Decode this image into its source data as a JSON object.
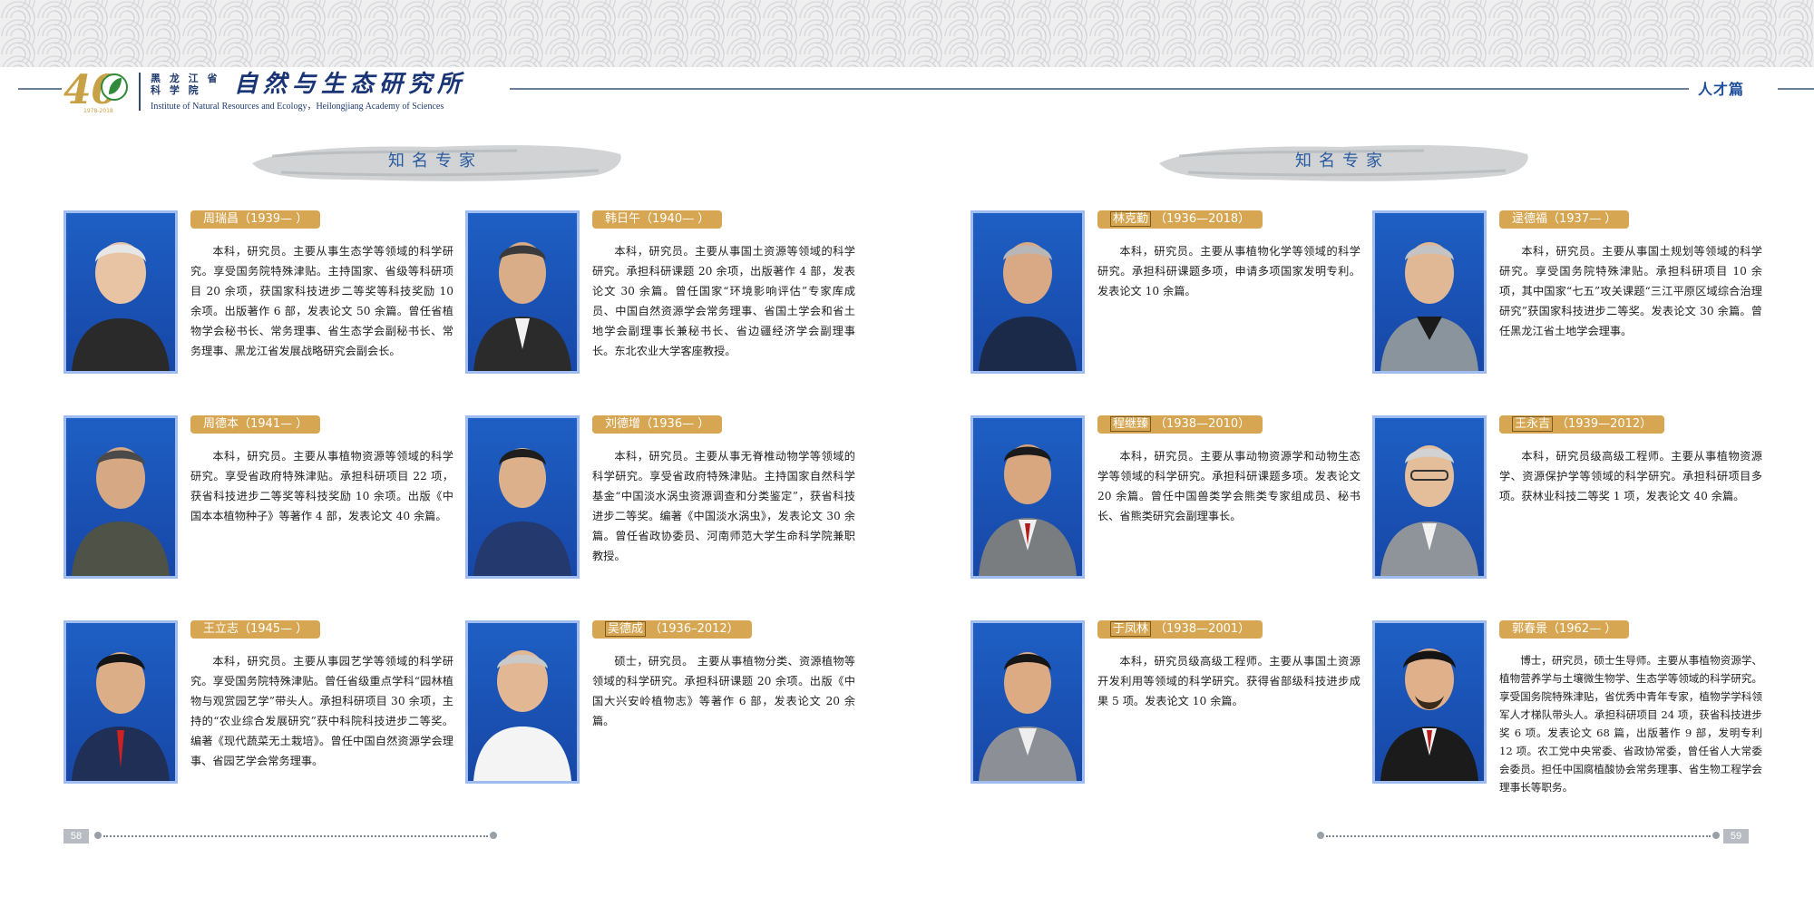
{
  "header": {
    "org_cn_line1": "黑 龙 江 省",
    "org_cn_line2": "科 学 院",
    "org_title": "自然与生态研究所",
    "org_en": "Institute of Natural Resources and Ecology，Heilongjiang Academy of Sciences",
    "logo_text": "40",
    "logo_years": "1978-2018",
    "section_tag": "人才篇",
    "colors": {
      "accent_blue": "#1f3a6e",
      "gold": "#c8a045",
      "tag_bg": "#d7a653"
    }
  },
  "left_page": {
    "banner_title": "知名专家",
    "page_number": "58",
    "experts": [
      {
        "name": "周瑞昌（1939— ）",
        "bio": "本科，研究员。主要从事生态学等领域的科学研究。享受国务院特殊津贴。主持国家、省级等科研项目 20 余项，获国家科技进步二等奖等科技奖励 10 余项。出版著作 6 部，发表论文 50 余篇。曾任省植物学会秘书长、常务理事、省生态学会副秘书长、常务理事、黑龙江省发展战略研究会副会长。"
      },
      {
        "name": "韩日午（1940— ）",
        "bio": "本科，研究员。主要从事国土资源等领域的科学研究。承担科研课题 20 余项，出版著作 4 部，发表论文 30 余篇。曾任国家“环境影响评估”专家库成员、中国自然资源学会常务理事、省国土学会和省土地学会副理事长兼秘书长、省边疆经济学会副理事长。东北农业大学客座教授。"
      },
      {
        "name": "周德本（1941— ）",
        "bio": "本科，研究员。主要从事植物资源等领域的科学研究。享受省政府特殊津贴。承担科研项目 22 项，获省科技进步二等奖等科技奖励 10 余项。出版《中国本本植物种子》等著作 4 部，发表论文 40 余篇。"
      },
      {
        "name": "刘德增（1936— ）",
        "bio": "本科，研究员。主要从事无脊椎动物学等领域的科学研究。享受省政府特殊津贴。主持国家自然科学基金“中国淡水涡虫资源调查和分类鉴定”，获省科技进步二等奖。编著《中国淡水涡虫》，发表论文 30 余篇。曾任省政协委员、河南师范大学生命科学院兼职教授。"
      },
      {
        "name": "王立志（1945— ）",
        "bio": "本科，研究员。主要从事园艺学等领域的科学研究。享受国务院特殊津贴。曾任省级重点学科“园林植物与观赏园艺学”带头人。承担科研项目 30 余项，主持的“农业综合发展研究”获中科院科技进步二等奖。编著《现代蔬菜无土栽培》。曾任中国自然资源学会理事、省园艺学会常务理事。"
      },
      {
        "name": "吴德成",
        "years": "（1936–2012）",
        "boxed": true,
        "bio": "硕士，研究员。 主要从事植物分类、资源植物等领域的科学研究。承担科研课题 20 余项。出版《中国大兴安岭植物志》等著作 6 部，发表论文 20 余篇。"
      }
    ]
  },
  "right_page": {
    "banner_title": "知名专家",
    "page_number": "59",
    "experts": [
      {
        "name": "林克勤",
        "years": "（1936—2018）",
        "boxed": true,
        "bio": "本科，研究员。主要从事植物化学等领域的科学研究。承担科研课题多项，申请多项国家发明专利。发表论文 10 余篇。"
      },
      {
        "name": "逯德福（1937— ）",
        "bio": "本科，研究员。主要从事国土规划等领域的科学研究。享受国务院特殊津贴。承担科研项目 10 余项，其中国家“七五”攻关课题“三江平原区域综合治理研究”获国家科技进步二等奖。发表论文 30 余篇。曾任黑龙江省土地学会理事。"
      },
      {
        "name": "程继臻",
        "years": "（1938—2010）",
        "boxed": true,
        "bio": "本科，研究员。主要从事动物资源学和动物生态学等领域的科学研究。承担科研课题多项。发表论文 20 余篇。曾任中国兽类学会熊类专家组成员、秘书长、省熊类研究会副理事长。"
      },
      {
        "name": "王永吉",
        "years": "（1939—2012）",
        "boxed": true,
        "bio": "本科，研究员级高级工程师。主要从事植物资源学、资源保护学等领域的科学研究。承担科研项目多项。获林业科技二等奖 1 项，发表论文 40 余篇。"
      },
      {
        "name": "于凤林",
        "years": "（1938—2001）",
        "boxed": true,
        "bio": "本科，研究员级高级工程师。主要从事国土资源开发利用等领域的科学研究。获得省部级科技进步成果 5 项。发表论文 10 余篇。"
      },
      {
        "name": "郭春景（1962— ）",
        "bio": "博士，研究员，硕士生导师。主要从事植物资源学、植物营养学与土壤微生物学、生态学等领域的科学研究。享受国务院特殊津贴，省优秀中青年专家，植物学学科领军人才梯队带头人。承担科研项目 24 项，获省科技进步奖 6 项。发表论文 68 篇，出版著作 9 部，发明专利 12 项。农工党中央常委、省政协常委，曾任省人大常委会委员。担任中国腐植酸协会常务理事、省生物工程学会理事长等职务。"
      }
    ]
  }
}
